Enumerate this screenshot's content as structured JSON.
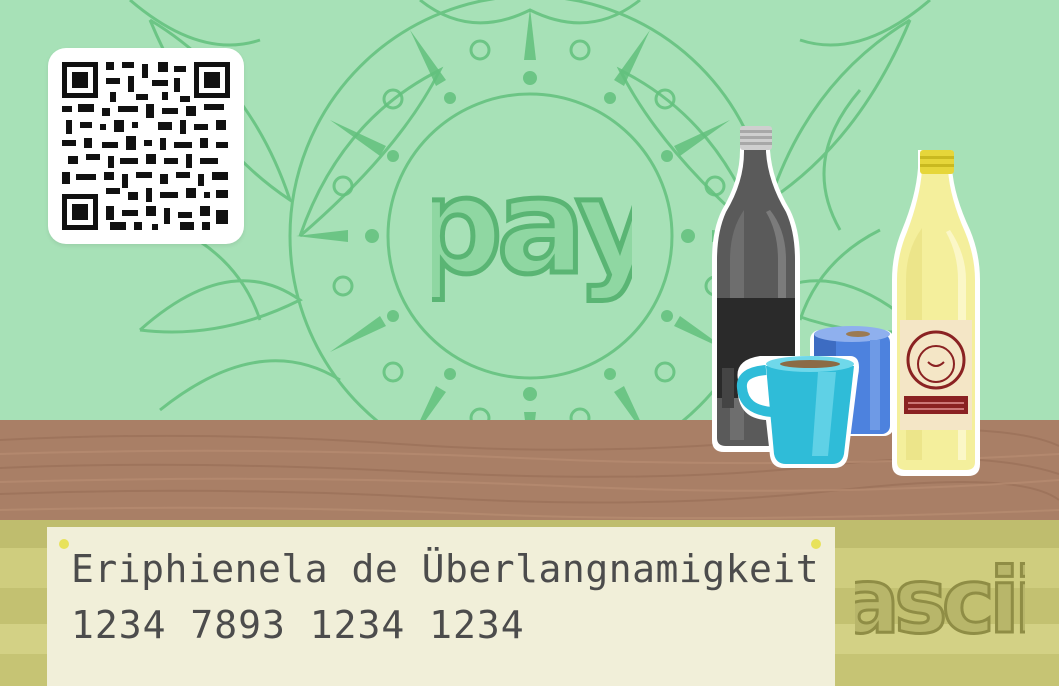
{
  "card": {
    "holder_name": "Eriphienela de Überlangnamigkeit",
    "number": "1234 7893 1234 1234"
  },
  "logos": {
    "payment_logo_text": "pay",
    "brand_logo_text": "ascii"
  },
  "icons": {
    "qr": "qr-code-icon",
    "bottle_dark": "dark-bottle-icon",
    "bottle_yellow": "yellow-bottle-icon",
    "cup_teal": "teal-cup-icon",
    "cup_blue": "blue-cup-icon"
  },
  "colors": {
    "background": "#a7e1b7",
    "mandala": "#5fbf7b",
    "shelf": "#a97f66",
    "strip": "#c9c777",
    "card_text": "#4c4c4c"
  }
}
